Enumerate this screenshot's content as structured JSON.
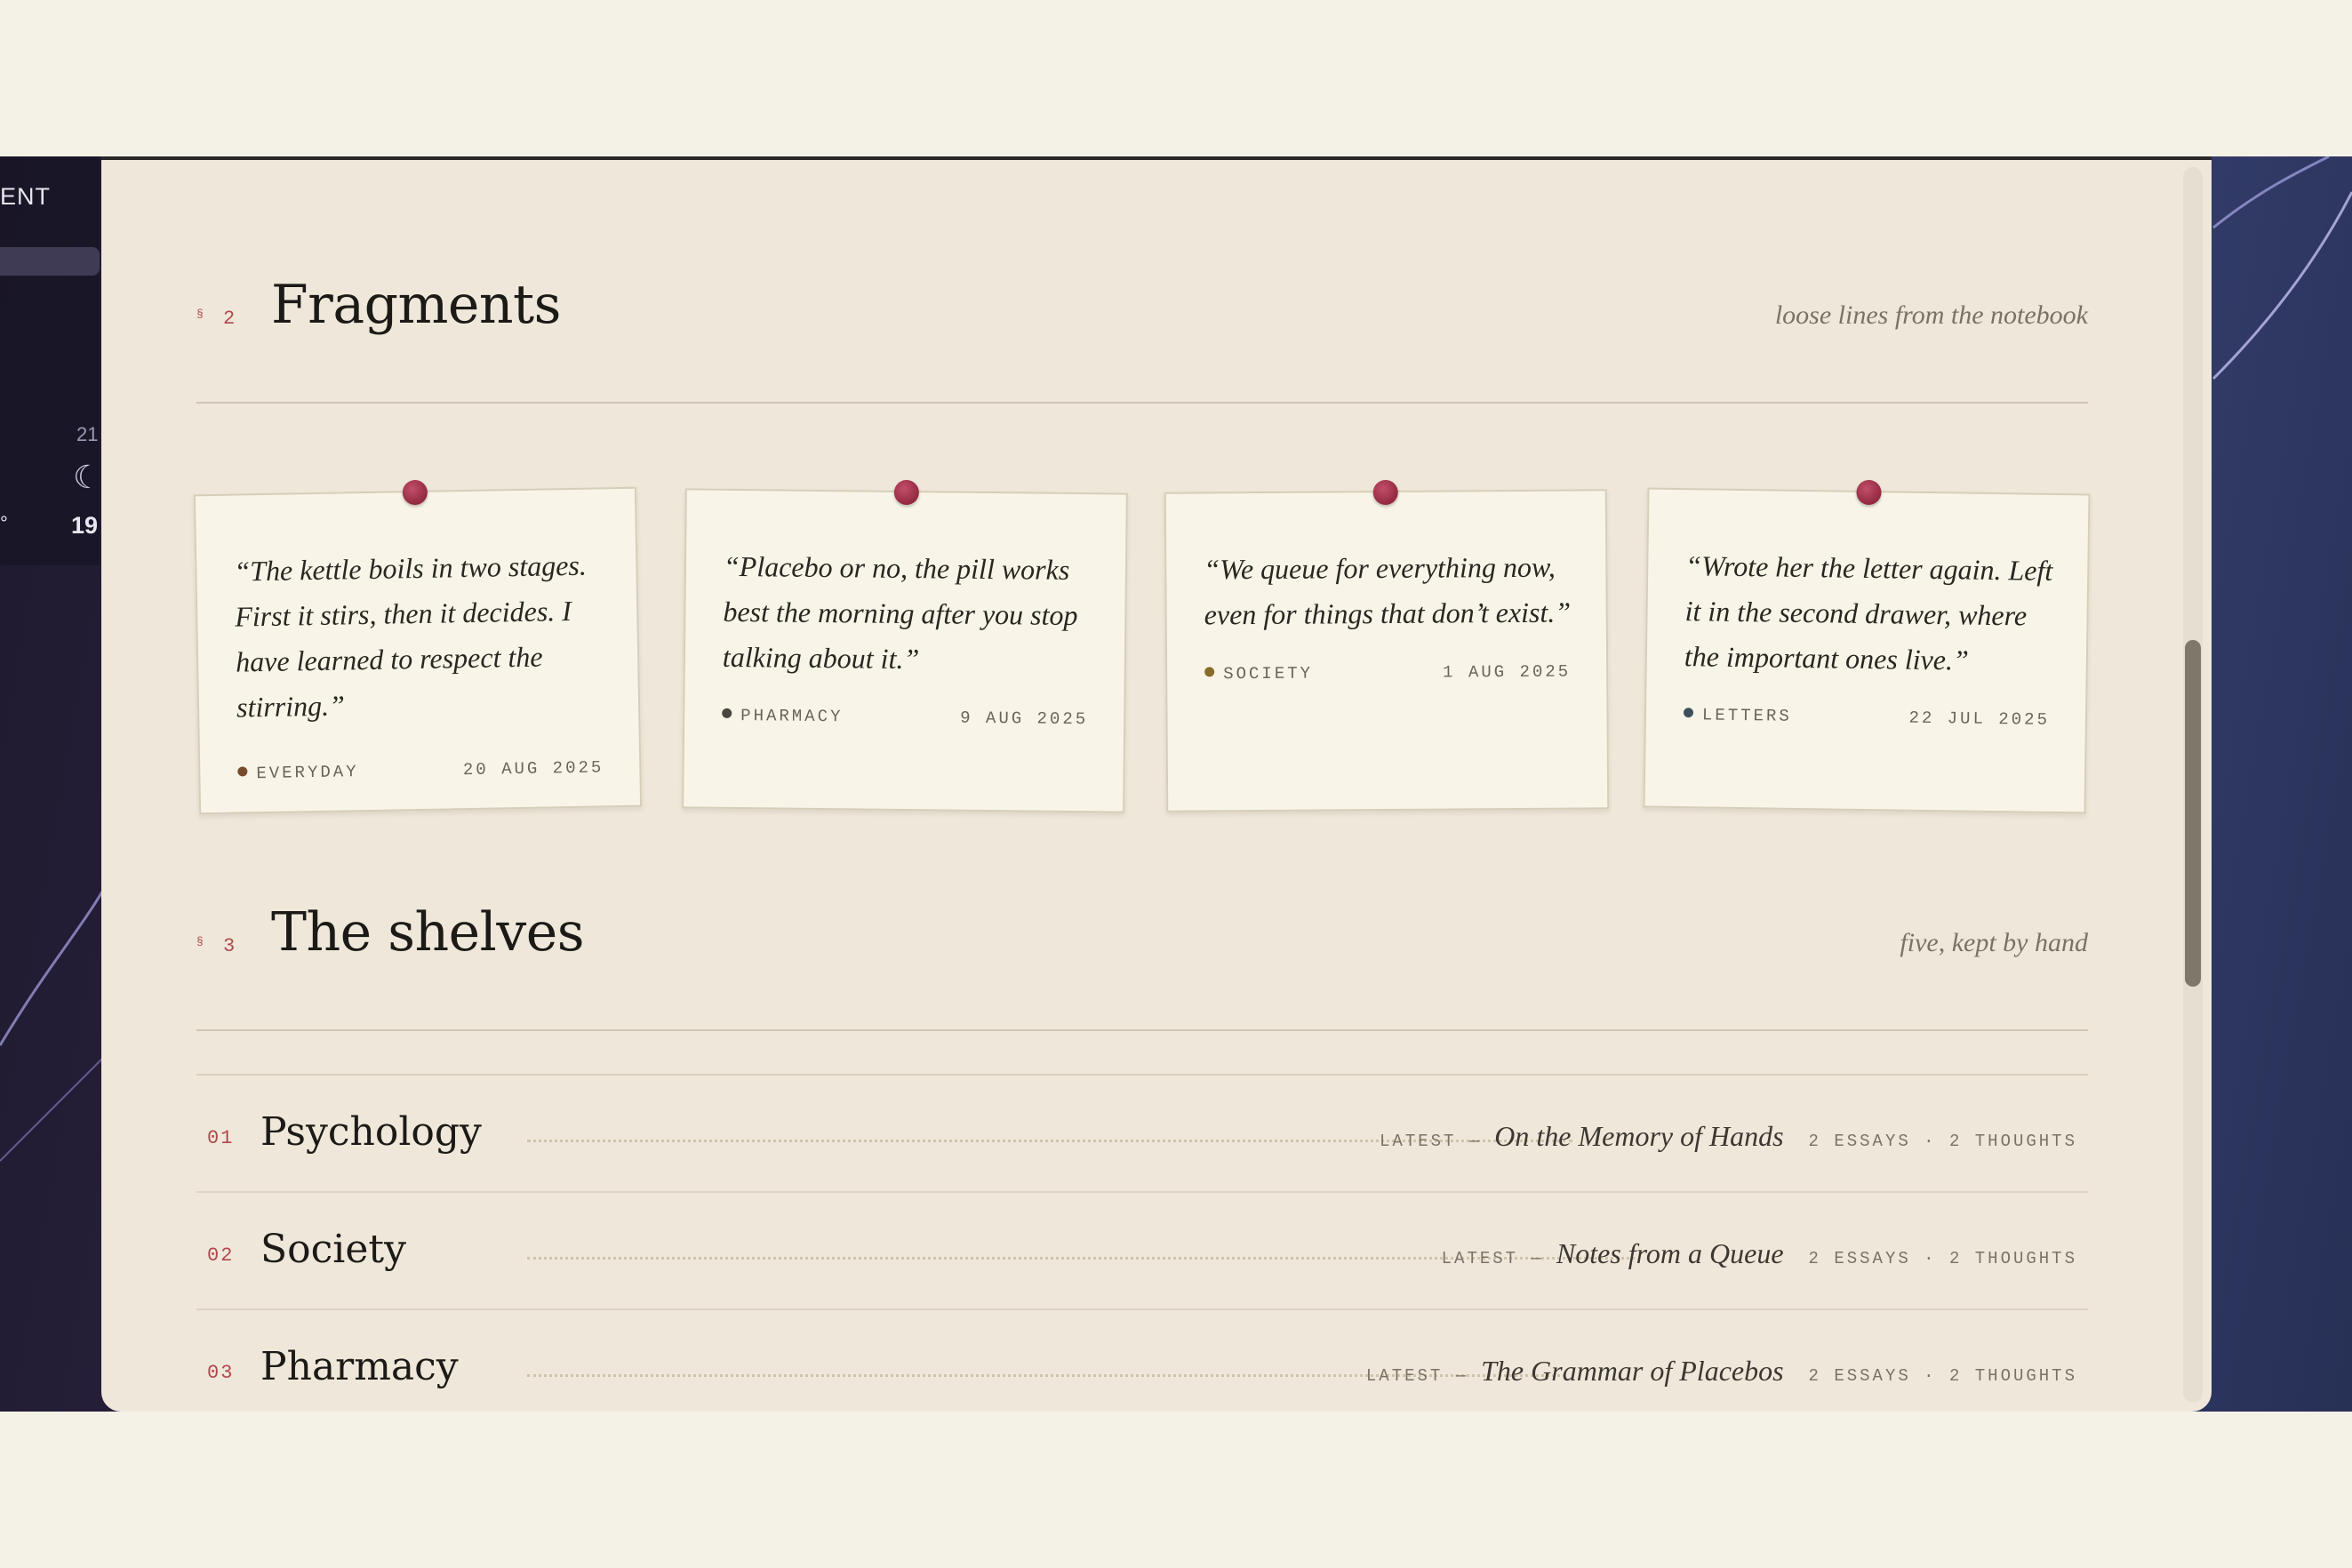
{
  "desktop": {
    "menu_text": "ENT",
    "clock_top": "21",
    "moon_glyph": "☾",
    "temp": "19",
    "degree": "°"
  },
  "fragments": {
    "mark": "§",
    "number": "2",
    "title": "Fragments",
    "subtitle": "loose lines from the notebook",
    "cards": [
      {
        "quote": "“The kettle boils in two stages. First it stirs, then it decides. I have learned to respect the stirring.”",
        "tag": "EVERYDAY",
        "tag_color": "#7a4a2c",
        "date": "20 AUG 2025"
      },
      {
        "quote": "“Placebo or no, the pill works best the morning after you stop talking about it.”",
        "tag": "PHARMACY",
        "tag_color": "#4a4640",
        "date": "9 AUG 2025"
      },
      {
        "quote": "“We queue for everything now, even for things that don’t exist.”",
        "tag": "SOCIETY",
        "tag_color": "#8a6a2a",
        "date": "1 AUG 2025"
      },
      {
        "quote": "“Wrote her the letter again. Left it in the second drawer, where the important ones live.”",
        "tag": "LETTERS",
        "tag_color": "#3e5060",
        "date": "22 JUL 2025"
      }
    ]
  },
  "shelves": {
    "mark": "§",
    "number": "3",
    "title": "The shelves",
    "subtitle": "five, kept by hand",
    "rows": [
      {
        "num": "01",
        "name": "Psychology",
        "latest_label": "LATEST —",
        "latest_title": "On the Memory of Hands",
        "counts": "2 ESSAYS · 2 THOUGHTS"
      },
      {
        "num": "02",
        "name": "Society",
        "latest_label": "LATEST —",
        "latest_title": "Notes from a Queue",
        "counts": "2 ESSAYS · 2 THOUGHTS"
      },
      {
        "num": "03",
        "name": "Pharmacy",
        "latest_label": "LATEST —",
        "latest_title": "The Grammar of Placebos",
        "counts": "2 ESSAYS · 2 THOUGHTS"
      }
    ]
  },
  "colors": {
    "accent": "#b0484e",
    "pin": "#a3304b",
    "paper": "#efe8da"
  }
}
